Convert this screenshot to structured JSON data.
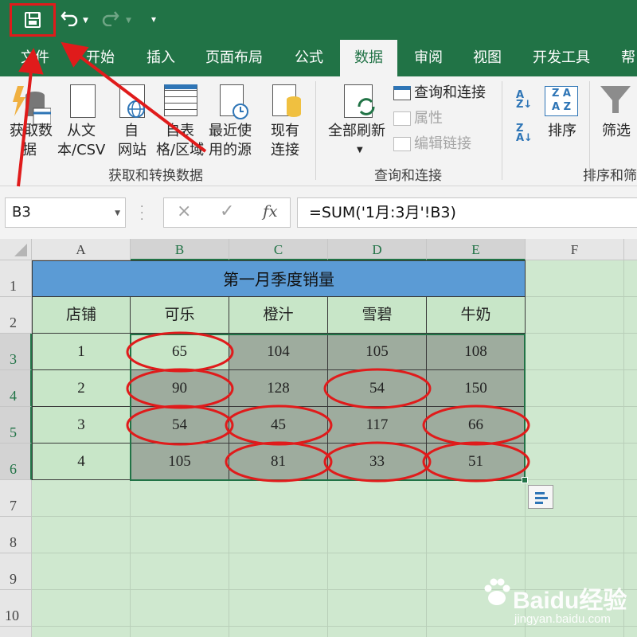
{
  "qat": {
    "save_icon": "save-icon",
    "undo_icon": "undo-icon",
    "redo_icon": "redo-icon",
    "customize_icon": "customize-qat-icon"
  },
  "tabs": [
    {
      "label": "文件",
      "active": false
    },
    {
      "label": "开始",
      "active": false
    },
    {
      "label": "插入",
      "active": false
    },
    {
      "label": "页面布局",
      "active": false
    },
    {
      "label": "公式",
      "active": false
    },
    {
      "label": "数据",
      "active": true
    },
    {
      "label": "审阅",
      "active": false
    },
    {
      "label": "视图",
      "active": false
    },
    {
      "label": "开发工具",
      "active": false
    },
    {
      "label": "帮",
      "active": false
    }
  ],
  "ribbon": {
    "get_transform": {
      "group_label": "获取和转换数据",
      "get_data_line1": "获取数",
      "get_data_line2": "据",
      "from_text_line1": "从文",
      "from_text_line2": "本/CSV",
      "from_web_line1": "自",
      "from_web_line2": "网站",
      "from_table_line1": "自表",
      "from_table_line2": "格/区域",
      "recent_line1": "最近使",
      "recent_line2": "用的源",
      "existing_line1": "现有",
      "existing_line2": "连接"
    },
    "queries": {
      "group_label": "查询和连接",
      "refresh_all": "全部刷新",
      "queries_connections": "查询和连接",
      "properties": "属性",
      "edit_links": "编辑链接"
    },
    "sort_filter": {
      "group_label": "排序和筛",
      "sort": "排序",
      "filter": "筛选"
    }
  },
  "formula_bar": {
    "name_box": "B3",
    "cancel_icon": "×",
    "enter_icon": "✓",
    "fx_icon": "fx",
    "formula": "=SUM('1月:3月'!B3)"
  },
  "sheet": {
    "columns": [
      "A",
      "B",
      "C",
      "D",
      "E",
      "F"
    ],
    "rows": [
      "1",
      "2",
      "3",
      "4",
      "5",
      "6",
      "7",
      "8",
      "9",
      "10"
    ],
    "title": "第一月季度销量",
    "headers": [
      "店铺",
      "可乐",
      "橙汁",
      "雪碧",
      "牛奶"
    ],
    "data": [
      [
        "1",
        "65",
        "104",
        "105",
        "108"
      ],
      [
        "2",
        "90",
        "128",
        "54",
        "150"
      ],
      [
        "3",
        "54",
        "45",
        "117",
        "66"
      ],
      [
        "4",
        "105",
        "81",
        "33",
        "51"
      ]
    ],
    "circled_values": [
      "65",
      "90",
      "54",
      "54",
      "45",
      "66",
      "81",
      "33",
      "51"
    ]
  },
  "watermark": {
    "title": "Baidu经验",
    "subtitle": "jingyan.baidu.com"
  },
  "colors": {
    "excel_green": "#217346",
    "title_fill": "#5b9bd5",
    "sheet_bg": "#cfe8cf",
    "selection_fill": "#9eac9e",
    "annotation_red": "#e01b1b"
  }
}
